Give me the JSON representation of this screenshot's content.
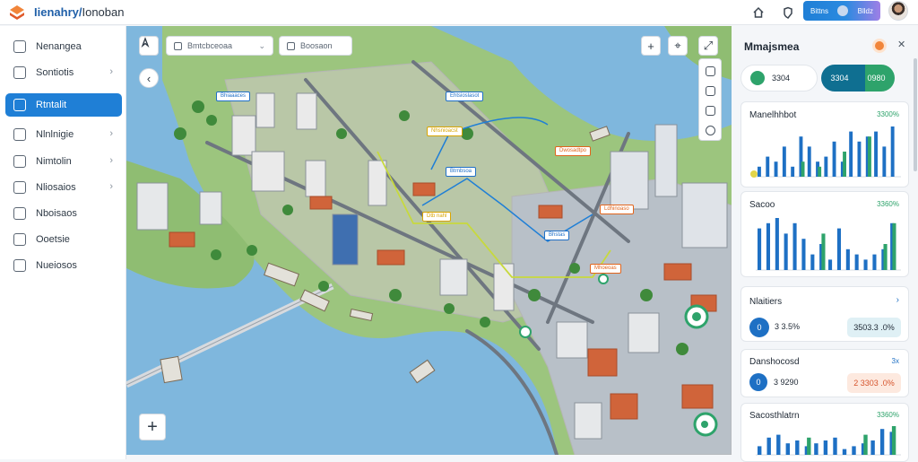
{
  "app": {
    "title": "Iienahry",
    "subtitle": "Ionoban"
  },
  "topbar": {
    "user_chip_left": "Bittns",
    "user_chip_right": "Blldz"
  },
  "sidebar": {
    "items": [
      {
        "label": "Nenangea",
        "chevron": false,
        "active": false,
        "icon": "building-icon"
      },
      {
        "label": "Sontiotis",
        "chevron": true,
        "active": false,
        "icon": "copy-icon"
      },
      {
        "label": "Rtntalit",
        "chevron": false,
        "active": true,
        "icon": "document-icon"
      },
      {
        "label": "Nlnlnigie",
        "chevron": true,
        "active": false,
        "icon": "globe-icon"
      },
      {
        "label": "Nimtolin",
        "chevron": true,
        "active": false,
        "icon": "folder-icon"
      },
      {
        "label": "Nliosaios",
        "chevron": true,
        "active": false,
        "icon": "transfer-icon"
      },
      {
        "label": "Nboisaos",
        "chevron": false,
        "active": false,
        "icon": "list-icon"
      },
      {
        "label": "Ooetsie",
        "chevron": false,
        "active": false,
        "icon": "wrench-icon"
      },
      {
        "label": "Nueiosos",
        "chevron": false,
        "active": false,
        "icon": "grid-icon"
      }
    ]
  },
  "map": {
    "search1_value": "Bmtcbceoaa",
    "search2_value": "Boosaon",
    "tags": [
      {
        "text": "Bhiaaaces",
        "color": "#1f6fc7"
      },
      {
        "text": "Ehtsioslasot",
        "color": "#1f6fc7"
      },
      {
        "text": "Nhsnioacst",
        "color": "#d9a400"
      },
      {
        "text": "Btrnbsoa",
        "color": "#1f6fc7"
      },
      {
        "text": "Dtb nahl",
        "color": "#d9a400"
      },
      {
        "text": "Dwosadtpo",
        "color": "#e1641c"
      },
      {
        "text": "Ldhinoaso",
        "color": "#e1641c"
      },
      {
        "text": "Bhstas",
        "color": "#1f6fc7"
      },
      {
        "text": "Mhoeoas",
        "color": "#e1641c"
      }
    ]
  },
  "panel": {
    "title": "Mmajsmea",
    "pill_left": "3304",
    "pill_right_a": "3304",
    "pill_right_b": "0980",
    "card1": {
      "title": "Manelhhbot",
      "value": "3300%"
    },
    "card2": {
      "title": "Sacoo",
      "value": "3360%"
    },
    "card3": {
      "title": "Nlaitiers",
      "left_value": "3 3.5%",
      "right_value": "3503.3 .0%"
    },
    "card4": {
      "title": "Danshocosd",
      "value": "3x",
      "left_value": "3 9290",
      "right_value": "2 3303 .0%"
    },
    "card5": {
      "title": "Sacosthlatrn",
      "value": "3360%"
    }
  },
  "chart_data": [
    {
      "type": "bar",
      "title": "Manelhhbot",
      "series": [
        {
          "values": [
            2,
            4,
            3,
            6,
            2,
            8,
            6,
            3,
            4,
            7,
            3,
            9,
            7,
            8,
            9,
            6,
            10
          ]
        },
        {
          "values": [
            0,
            0,
            0,
            0,
            0,
            3,
            0,
            2,
            0,
            0,
            5,
            0,
            0,
            8,
            0,
            0,
            0
          ]
        }
      ],
      "colors": [
        "#1e70c4",
        "#2ea36b"
      ]
    },
    {
      "type": "bar",
      "title": "Sacoo",
      "series": [
        {
          "values": [
            8,
            9,
            10,
            7,
            9,
            6,
            3,
            5,
            2,
            8,
            4,
            3,
            2,
            3,
            4,
            9
          ]
        },
        {
          "values": [
            0,
            0,
            0,
            0,
            0,
            0,
            0,
            7,
            0,
            0,
            0,
            0,
            0,
            0,
            5,
            9
          ]
        }
      ],
      "colors": [
        "#1e70c4",
        "#2ea36b"
      ]
    },
    {
      "type": "bar",
      "title": "Sacosthlatrn",
      "series": [
        {
          "values": [
            3,
            6,
            7,
            4,
            5,
            3,
            4,
            5,
            6,
            2,
            3,
            4,
            5,
            9,
            8
          ]
        },
        {
          "values": [
            0,
            0,
            0,
            0,
            0,
            6,
            0,
            0,
            0,
            0,
            0,
            7,
            0,
            0,
            10
          ]
        }
      ],
      "colors": [
        "#1e70c4",
        "#2ea36b"
      ]
    }
  ]
}
